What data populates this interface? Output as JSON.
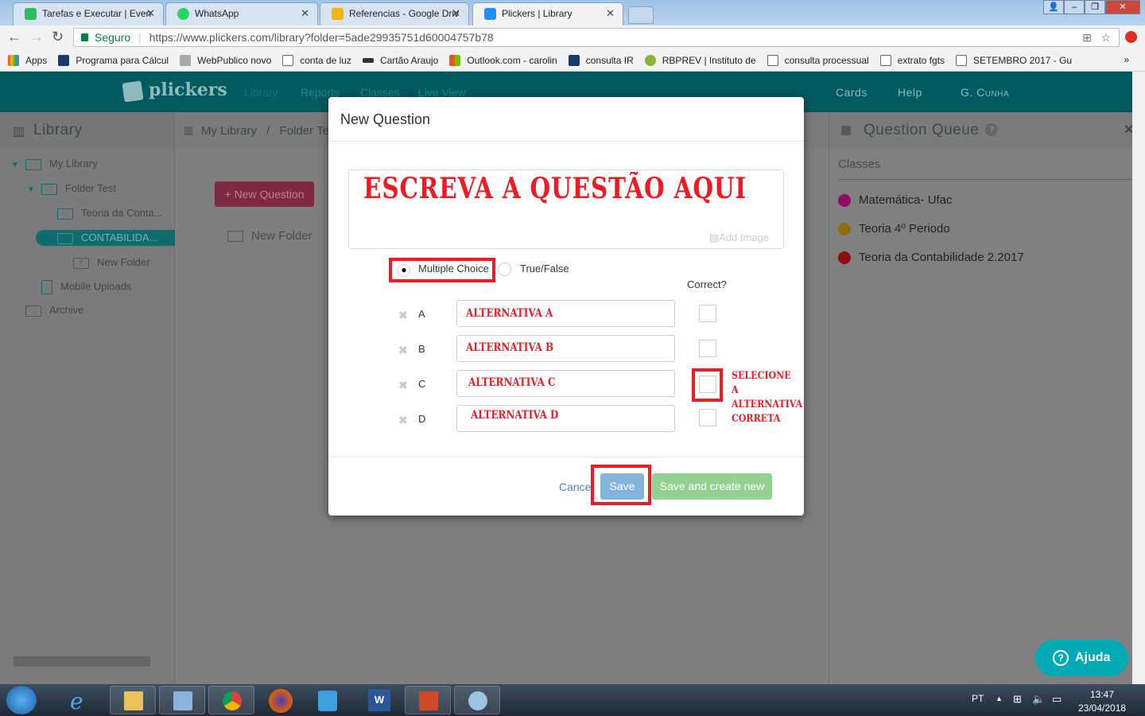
{
  "browser": {
    "tabs": [
      {
        "title": "Tarefas e Executar | Everr",
        "icon_color": "#2dbe60"
      },
      {
        "title": "WhatsApp",
        "icon_color": "#25d366"
      },
      {
        "title": "Referencias - Google Driv",
        "icon_color": "#f4b400"
      },
      {
        "title": "Plickers | Library",
        "icon_color": "#1e90ff",
        "active": true
      }
    ],
    "secure_label": "Seguro",
    "url": "https://www.plickers.com/library?folder=5ade29935751d60004757b78",
    "bookmarks": [
      "Apps",
      "Programa para Cálcul",
      "WebPublico novo",
      "conta de luz",
      "Cartão Araujo",
      "Outlook.com - carolin",
      "consulta IR",
      "RBPREV | Instituto de",
      "consulta processual",
      "extrato fgts",
      "SETEMBRO 2017 - Gu"
    ],
    "bookmarks_more": "»"
  },
  "app": {
    "logo": "plickers",
    "nav": [
      "Library",
      "Reports",
      "Classes",
      "Live View"
    ],
    "nav_right": [
      "Cards",
      "Help",
      "G. Cunha"
    ]
  },
  "left_panel": {
    "title": "Library",
    "tree": [
      "My Library",
      "Folder Test",
      "Teoria da Conta...",
      "CONTABILIDA...",
      "New Folder",
      "Mobile Uploads",
      "Archive"
    ]
  },
  "center": {
    "breadcrumb": [
      "My Library",
      "/",
      "Folder Test"
    ],
    "new_question": "+ New Question",
    "new_folder": "New Folder"
  },
  "right_panel": {
    "title": "Question Queue",
    "classes_label": "Classes",
    "classes": [
      {
        "name": "Matemática- Ufac",
        "color": "#8b1060"
      },
      {
        "name": "Teoria 4º Periodo",
        "color": "#8f6d0a"
      },
      {
        "name": "Teoria da Contabilidade 2.2017",
        "color": "#8a1010"
      }
    ]
  },
  "modal": {
    "title": "New Question",
    "question_text": "ESCREVA A QUESTÃO AQUI",
    "add_image": "Add Image",
    "types": [
      "Multiple Choice",
      "True/False"
    ],
    "selected_type": "Multiple Choice",
    "correct_label": "Correct?",
    "answers": [
      {
        "letter": "A",
        "text": "ALTERNATIVA A",
        "correct": false
      },
      {
        "letter": "B",
        "text": "ALTERNATIVA B",
        "correct": false
      },
      {
        "letter": "C",
        "text": "ALTERNATIVA C",
        "correct": false
      },
      {
        "letter": "D",
        "text": "ALTERNATIVA D",
        "correct": false
      }
    ],
    "annotation": "SELECIONE A ALTERNATIVA CORRETA",
    "cancel": "Cancel",
    "save": "Save",
    "save_new": "Save and create new"
  },
  "help_button": "Ajuda",
  "taskbar": {
    "lang": "PT",
    "time": "13:47",
    "date": "23/04/2018"
  }
}
